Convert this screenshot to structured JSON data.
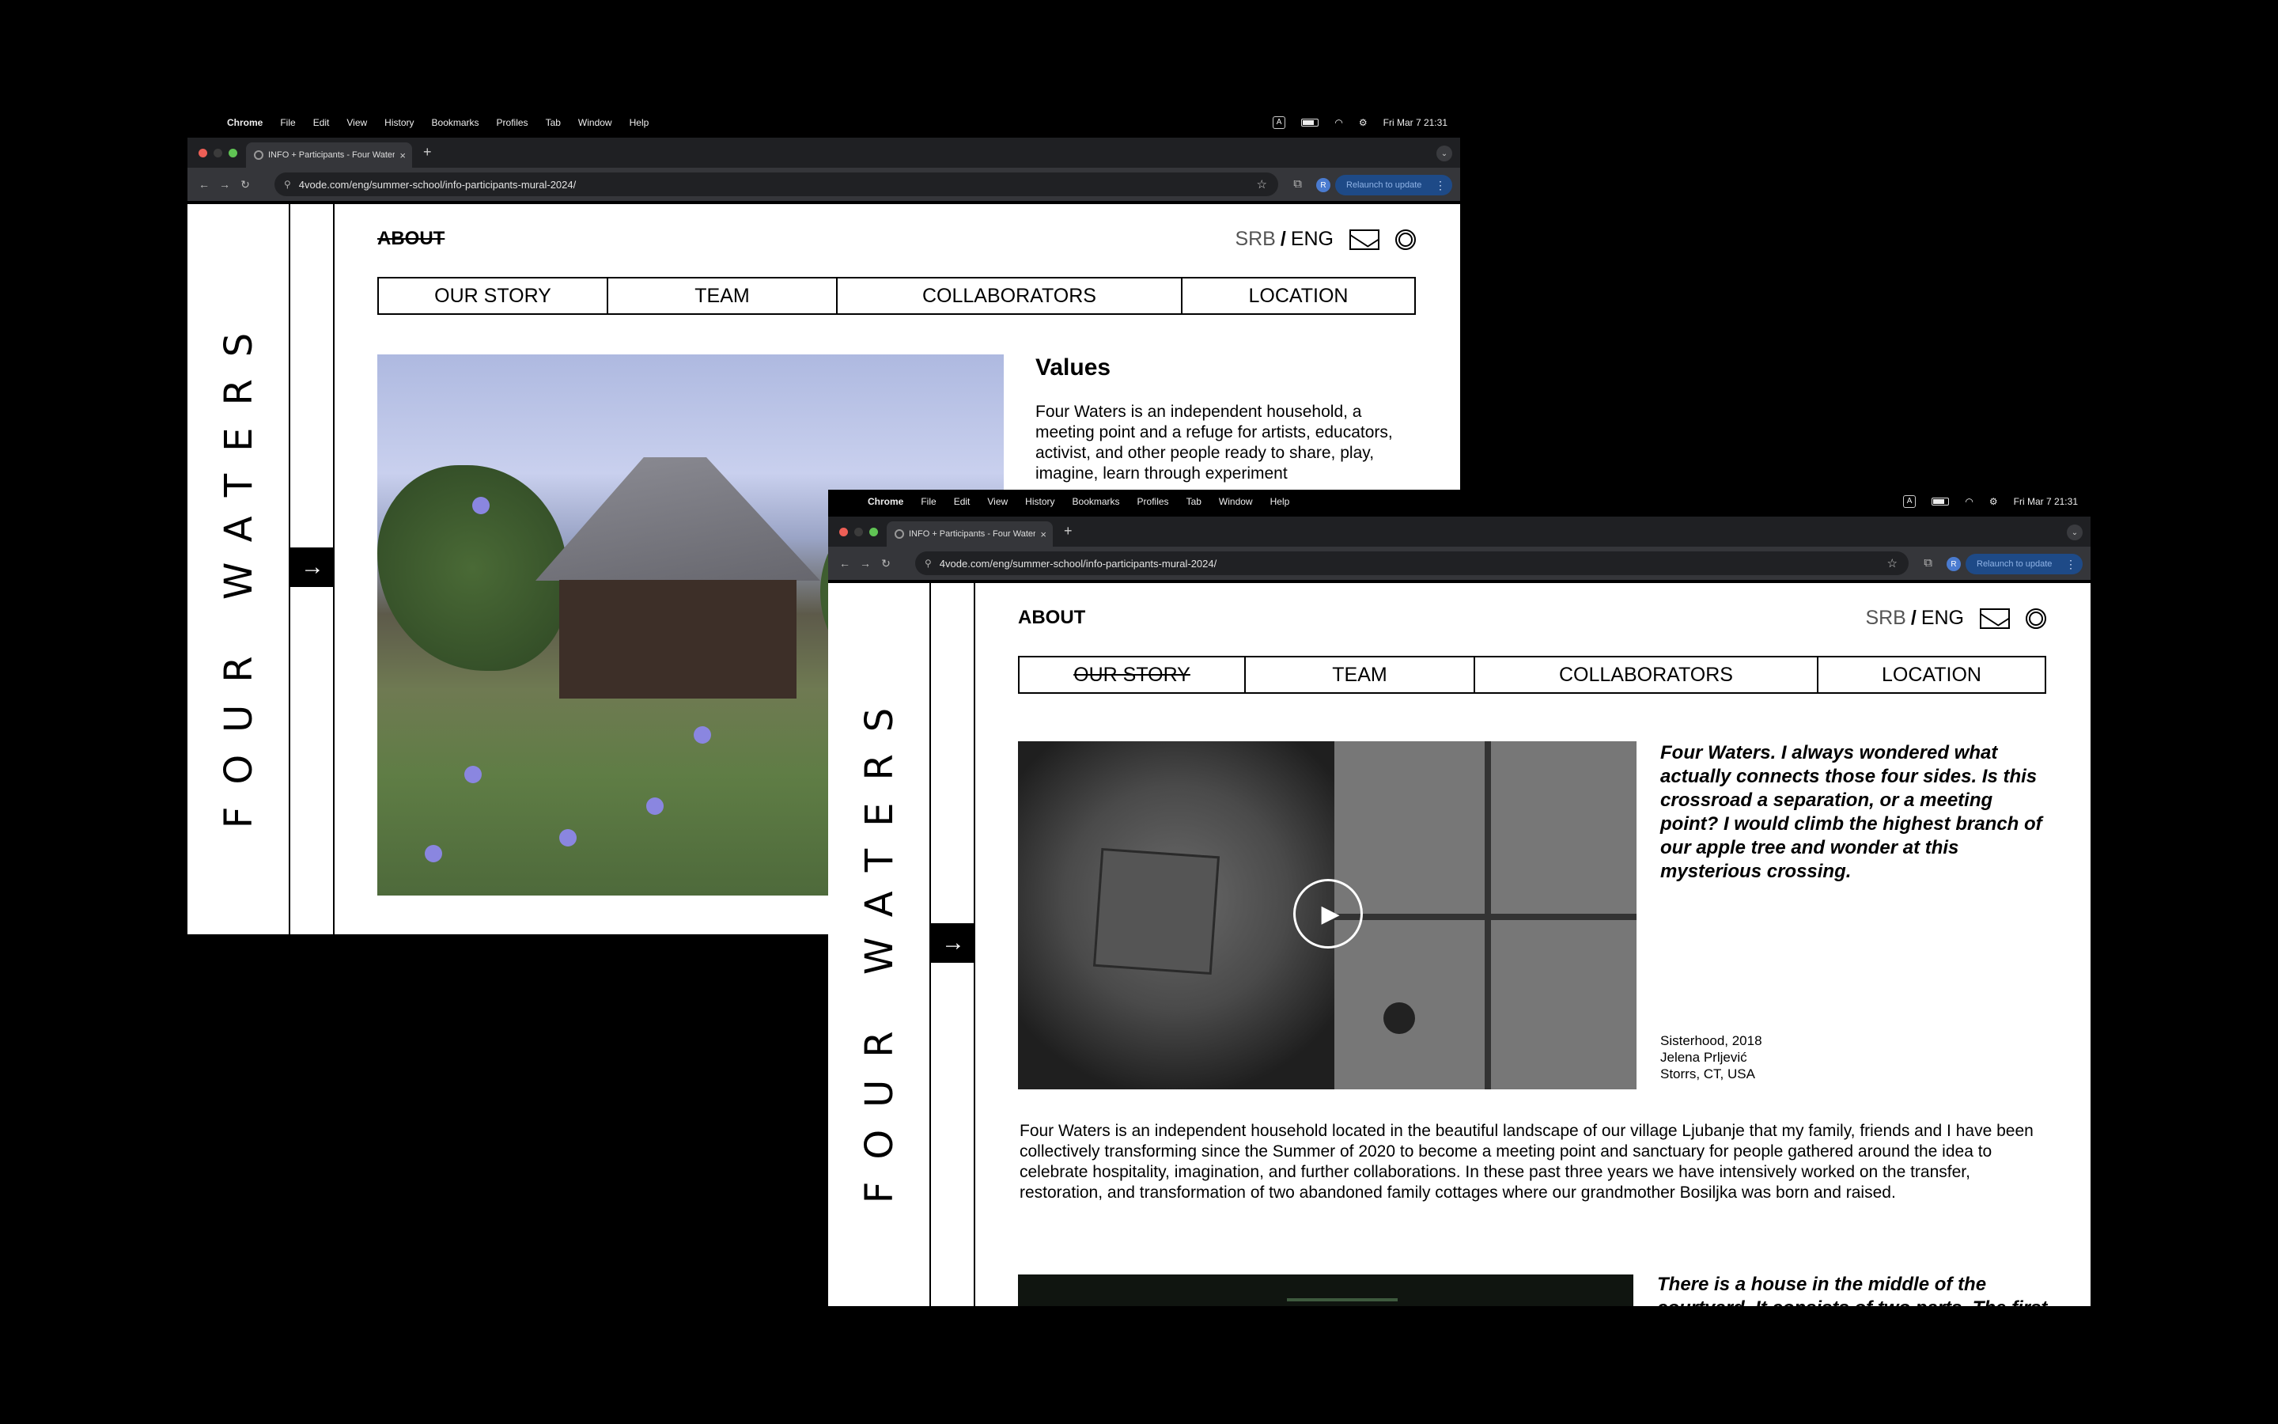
{
  "menubar": {
    "app_name": "Chrome",
    "items": [
      "File",
      "Edit",
      "View",
      "History",
      "Bookmarks",
      "Profiles",
      "Tab",
      "Window",
      "Help"
    ],
    "input_indicator": "A",
    "datetime": "Fri Mar 7  21:31"
  },
  "browser": {
    "tab_title": "INFO + Participants - Four Waters",
    "tab_close": "×",
    "new_tab": "+",
    "url": "4vode.com/eng/summer-school/info-participants-mural-2024/",
    "relaunch_label": "Relaunch to update",
    "profile_initial": "R"
  },
  "site": {
    "brand": "FOUR WATERS",
    "about": "ABOUT",
    "lang_srb": "SRB",
    "lang_sep": "/",
    "lang_eng": "ENG",
    "nav": [
      "OUR STORY",
      "TEAM",
      "COLLABORATORS",
      "LOCATION"
    ]
  },
  "window1": {
    "values_title": "Values",
    "values_text": "Four Waters is an independent household, a meeting point and a refuge for artists, educators, activist, and other people ready to share, play, imagine, learn through experiment"
  },
  "window2": {
    "quote": "Four Waters. I always wondered what actually connects those four sides. Is this crossroad a separation, or a meeting point? I would climb the highest branch of our apple tree and wonder at this mysterious crossing.",
    "caption": [
      "Sisterhood, 2018",
      "Jelena Prljević",
      "Storrs, CT, USA"
    ],
    "paragraph": "Four Waters is an independent household located in the beautiful landscape of our village Ljubanje that my family, friends and I have been collectively transforming since the Summer of 2020 to become a meeting point and sanctuary for people gathered around the idea to celebrate hospitality, imagination, and further collaborations. In these past three years we have intensively worked on the transfer, restoration, and transformation of two abandoned family cottages where our grandmother Bosiljka was born and raised.",
    "quote2": "There is a house in the middle of the courtyard. It consists of two parts. The first"
  },
  "icons": {
    "apple": "apple-icon",
    "wifi": "wifi-icon",
    "battery": "battery-icon",
    "mail": "mail-icon",
    "instagram": "instagram-icon",
    "arrow": "arrow-right-icon",
    "play": "play-icon"
  }
}
